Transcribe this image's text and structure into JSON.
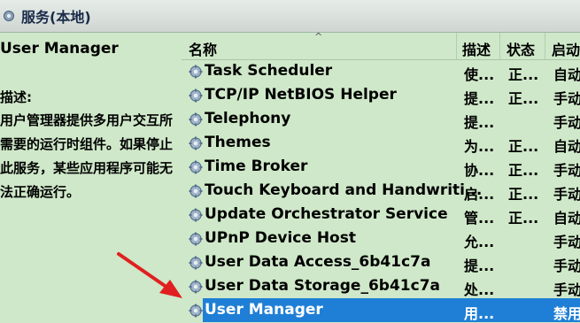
{
  "window": {
    "title": "服务(本地)",
    "title_icon": "gear-icon"
  },
  "details": {
    "service_name": "User Manager",
    "description_label": "描述:",
    "description_text": "用户管理器提供多用户交互所需要的运行时组件。如果停止此服务，某些应用程序可能无法正确运行。"
  },
  "columns": {
    "name": "名称",
    "description": "描述",
    "status": "状态",
    "startup": "启动"
  },
  "services": [
    {
      "name": "Task Scheduler",
      "description": "使...",
      "status": "正...",
      "startup": "自动"
    },
    {
      "name": "TCP/IP NetBIOS Helper",
      "description": "提...",
      "status": "正...",
      "startup": "手动"
    },
    {
      "name": "Telephony",
      "description": "提...",
      "status": "",
      "startup": "手动"
    },
    {
      "name": "Themes",
      "description": "为...",
      "status": "正...",
      "startup": "自动"
    },
    {
      "name": "Time Broker",
      "description": "协...",
      "status": "正...",
      "startup": "手动"
    },
    {
      "name": "Touch Keyboard and Handwriti...",
      "description": "启...",
      "status": "正...",
      "startup": "手动"
    },
    {
      "name": "Update Orchestrator Service",
      "description": "管...",
      "status": "正...",
      "startup": "自动"
    },
    {
      "name": "UPnP Device Host",
      "description": "允...",
      "status": "",
      "startup": "手动"
    },
    {
      "name": "User Data Access_6b41c7a",
      "description": "提...",
      "status": "",
      "startup": "手动"
    },
    {
      "name": "User Data Storage_6b41c7a",
      "description": "处...",
      "status": "",
      "startup": "手动"
    },
    {
      "name": "User Manager",
      "description": "用...",
      "status": "",
      "startup": "禁用",
      "selected": true
    }
  ],
  "colors": {
    "background": "#cfe8c9",
    "selection": "#1f7fd6",
    "arrow": "#e02020"
  }
}
